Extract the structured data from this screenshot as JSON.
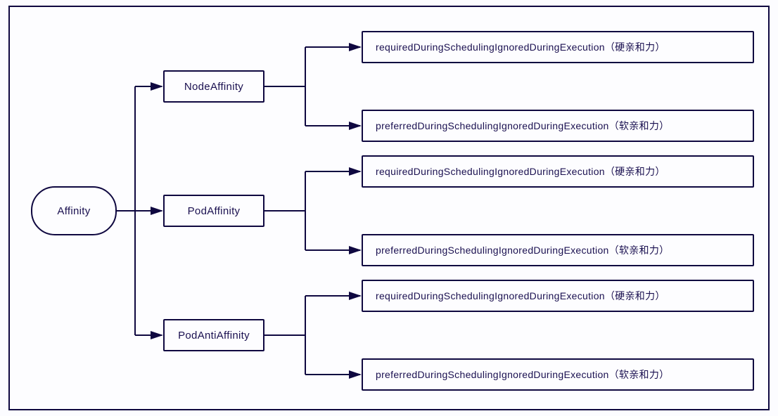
{
  "root": {
    "label": "Affinity"
  },
  "mids": [
    {
      "label": "NodeAffinity"
    },
    {
      "label": "PodAffinity"
    },
    {
      "label": "PodAntiAffinity"
    }
  ],
  "leaves": [
    {
      "label": "requiredDuringSchedulingIgnoredDuringExecution（硬亲和力）"
    },
    {
      "label": "preferredDuringSchedulingIgnoredDuringExecution（软亲和力）"
    },
    {
      "label": "requiredDuringSchedulingIgnoredDuringExecution（硬亲和力）"
    },
    {
      "label": "preferredDuringSchedulingIgnoredDuringExecution（软亲和力）"
    },
    {
      "label": "requiredDuringSchedulingIgnoredDuringExecution（硬亲和力）"
    },
    {
      "label": "preferredDuringSchedulingIgnoredDuringExecution（软亲和力）"
    }
  ]
}
